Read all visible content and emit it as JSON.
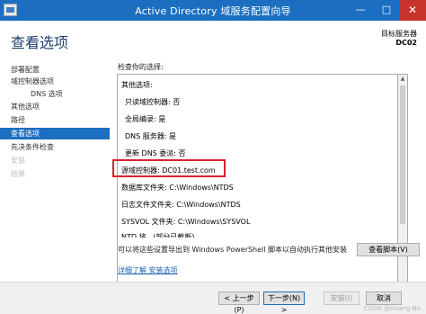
{
  "window": {
    "title": "Active Directory 域服务配置向导",
    "minimize_glyph": "—",
    "maximize_glyph": "□",
    "close_glyph": "✕"
  },
  "header": {
    "page_title": "查看选项",
    "target_label": "目标服务器",
    "target_value": "DC02"
  },
  "nav": {
    "items": [
      {
        "label": "部署配置",
        "state": "normal"
      },
      {
        "label": "域控制器选项",
        "state": "normal"
      },
      {
        "label": "DNS 选项",
        "state": "indent"
      },
      {
        "label": "其他选项",
        "state": "normal"
      },
      {
        "label": "路径",
        "state": "normal"
      },
      {
        "label": "查看选项",
        "state": "active"
      },
      {
        "label": "先决条件检查",
        "state": "normal"
      },
      {
        "label": "安装",
        "state": "disabled"
      },
      {
        "label": "结果",
        "state": "disabled"
      }
    ]
  },
  "review": {
    "section_label": "检查你的选择:",
    "lines": [
      "其他选项:",
      "只读域控制器: 否",
      "全局编录: 是",
      "DNS 服务器: 是",
      "更新 DNS 委派: 否",
      "源域控制器: DC01.test.com",
      "数据库文件夹: C:\\Windows\\NTDS",
      "日志文件文件夹: C:\\Windows\\NTDS",
      "SYSVOL 文件夹: C:\\Windows\\SYSVOL",
      "NTD 将...(部分已截断)"
    ],
    "scroll_up_glyph": "▲",
    "scroll_down_glyph": "▼"
  },
  "export": {
    "text": "可以将这些设置导出到 Windows PowerShell 脚本以自动执行其他安装",
    "button_label": "查看脚本(V)"
  },
  "more_link": "详细了解 安装选项",
  "footer": {
    "prev_label": "< 上一步(P)",
    "next_label": "下一步(N) >",
    "install_label": "安装(I)",
    "cancel_label": "取消"
  },
  "watermark": "CSDN @Huang-Bo"
}
